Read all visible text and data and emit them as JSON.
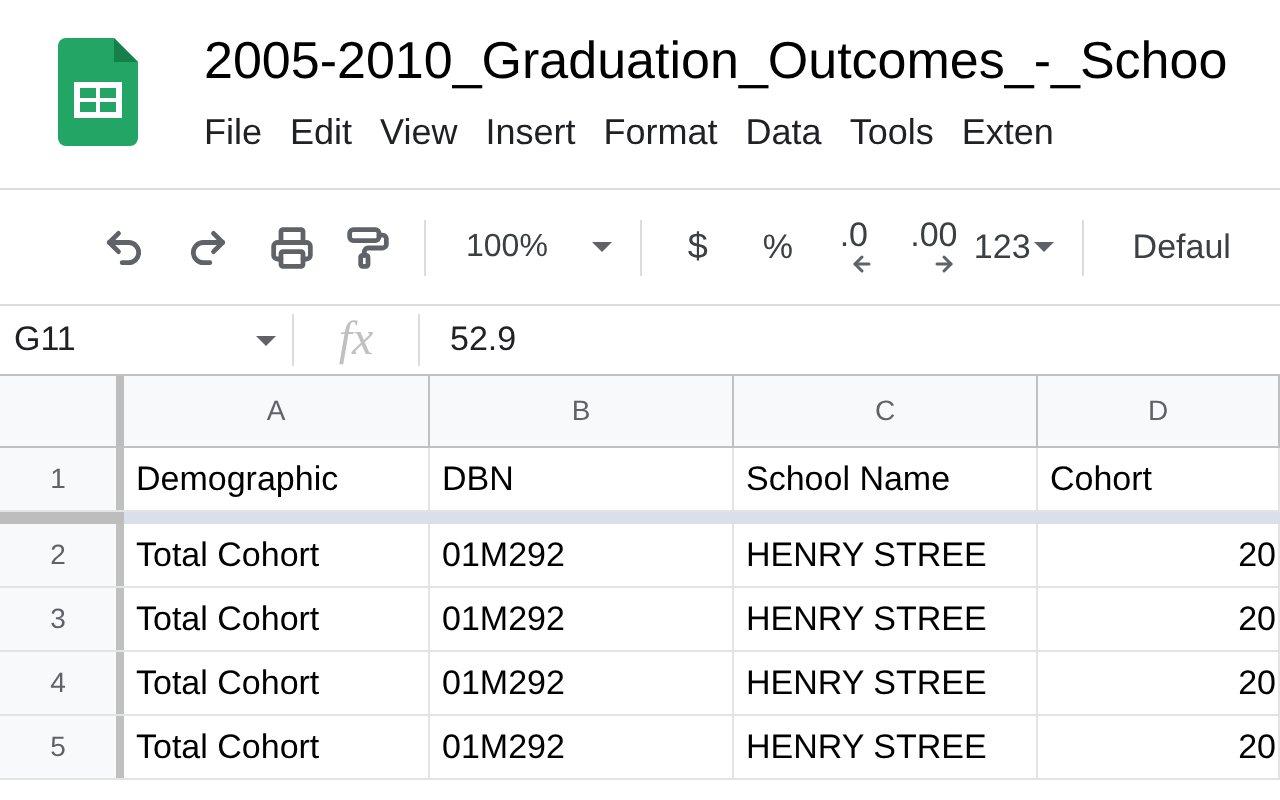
{
  "document": {
    "title": "2005-2010_Graduation_Outcomes_-_Schoo"
  },
  "menu": [
    "File",
    "Edit",
    "View",
    "Insert",
    "Format",
    "Data",
    "Tools",
    "Exten"
  ],
  "toolbar": {
    "zoom": "100%",
    "currency": "$",
    "percent": "%",
    "decrease_decimal": ".0",
    "increase_decimal": ".00",
    "number_format": "123",
    "font": "Defaul"
  },
  "formula_bar": {
    "cell_ref": "G11",
    "fx": "fx",
    "value": "52.9"
  },
  "sheet": {
    "columns": [
      "A",
      "B",
      "C",
      "D"
    ],
    "rows": [
      {
        "number": "1",
        "cells": [
          "Demographic",
          "DBN",
          "School Name",
          "Cohort"
        ]
      },
      {
        "number": "2",
        "cells": [
          "Total Cohort",
          "01M292",
          "HENRY STREE",
          "20"
        ]
      },
      {
        "number": "3",
        "cells": [
          "Total Cohort",
          "01M292",
          "HENRY STREE",
          "20"
        ]
      },
      {
        "number": "4",
        "cells": [
          "Total Cohort",
          "01M292",
          "HENRY STREE",
          "20"
        ]
      },
      {
        "number": "5",
        "cells": [
          "Total Cohort",
          "01M292",
          "HENRY STREE",
          "20"
        ]
      }
    ]
  }
}
